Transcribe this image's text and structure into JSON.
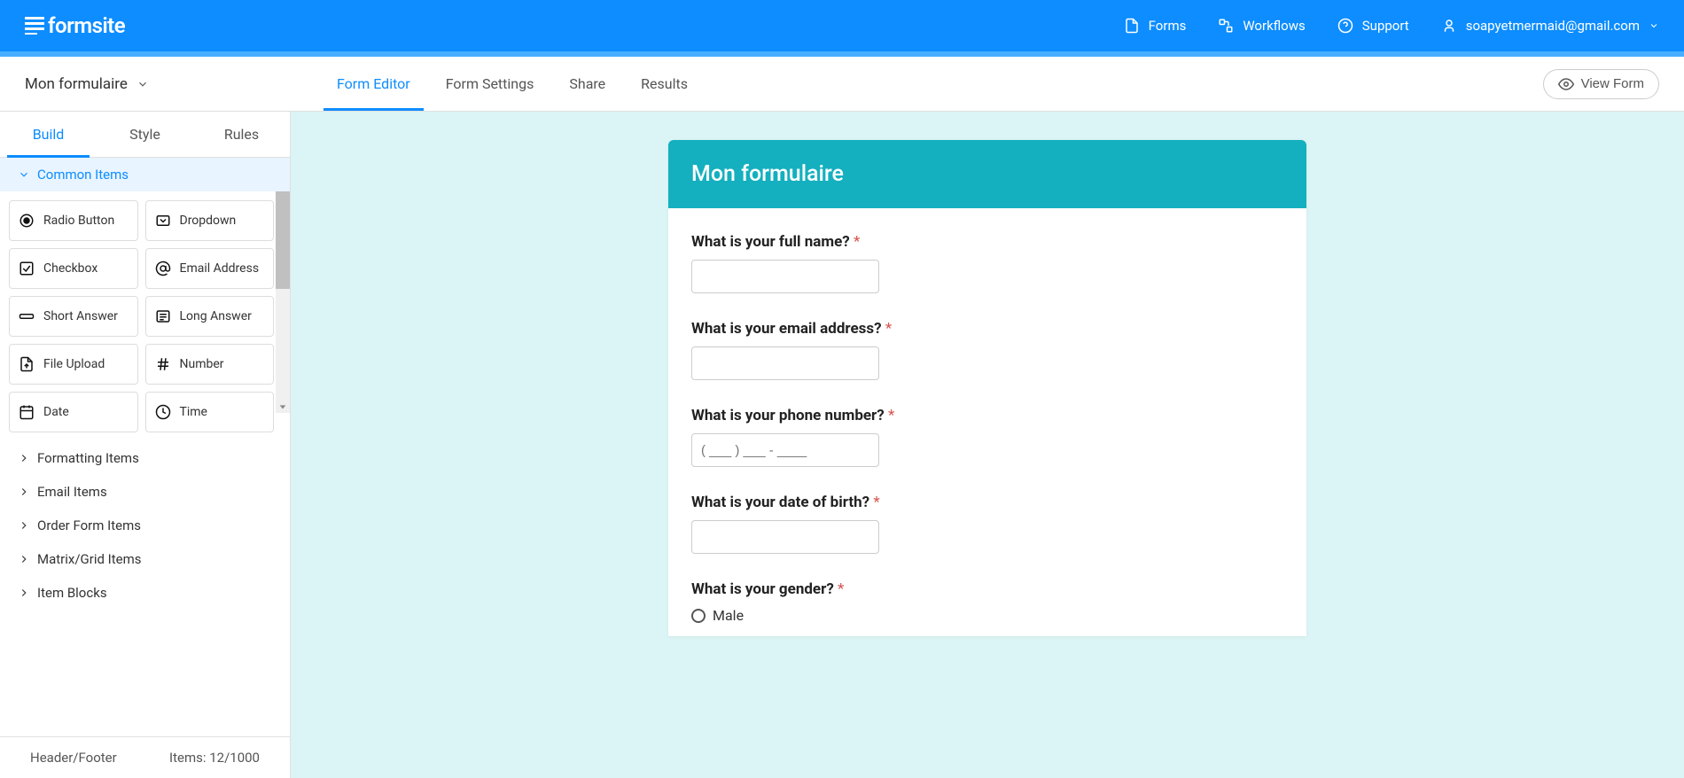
{
  "brand": "formsite",
  "topNav": {
    "forms": "Forms",
    "workflows": "Workflows",
    "support": "Support"
  },
  "user": {
    "email": "soapyetmermaid@gmail.com"
  },
  "formTitle": "Mon formulaire",
  "subTabs": {
    "editor": "Form Editor",
    "settings": "Form Settings",
    "share": "Share",
    "results": "Results"
  },
  "viewForm": "View Form",
  "sidebarTabs": {
    "build": "Build",
    "style": "Style",
    "rules": "Rules"
  },
  "categories": {
    "common": "Common Items",
    "formatting": "Formatting Items",
    "email": "Email Items",
    "order": "Order Form Items",
    "matrix": "Matrix/Grid Items",
    "blocks": "Item Blocks"
  },
  "items": {
    "radio": "Radio Button",
    "dropdown": "Dropdown",
    "checkbox": "Checkbox",
    "emailaddr": "Email Address",
    "short": "Short Answer",
    "long": "Long Answer",
    "upload": "File Upload",
    "number": "Number",
    "date": "Date",
    "time": "Time"
  },
  "footer": {
    "headerFooter": "Header/Footer",
    "itemsCount": "Items: 12/1000"
  },
  "form": {
    "title": "Mon formulaire",
    "q1": "What is your full name?",
    "q2": "What is your email address?",
    "q3": "What is your phone number?",
    "q3placeholder": "( ___ ) ___ - ____",
    "q4": "What is your date of birth?",
    "q5": "What is your gender?",
    "opt_male": "Male"
  }
}
